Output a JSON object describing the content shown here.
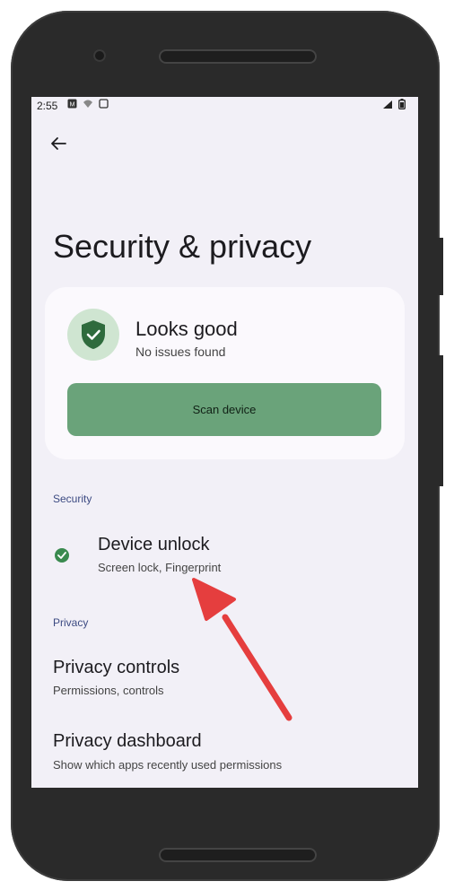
{
  "status_bar": {
    "time": "2:55",
    "left_icons": [
      "notification-icon",
      "wifi-off-icon",
      "screen-icon"
    ],
    "right_icons": [
      "signal-icon",
      "battery-icon"
    ]
  },
  "header": {
    "back_icon": "arrow-back-icon",
    "title": "Security & privacy"
  },
  "status_card": {
    "icon": "shield-check-icon",
    "title": "Looks good",
    "subtitle": "No issues found",
    "button_label": "Scan device"
  },
  "sections": {
    "security": {
      "label": "Security",
      "items": [
        {
          "icon": "check-circle-icon",
          "title": "Device unlock",
          "subtitle": "Screen lock, Fingerprint"
        }
      ]
    },
    "privacy": {
      "label": "Privacy",
      "items": [
        {
          "title": "Privacy controls",
          "subtitle": "Permissions, controls"
        },
        {
          "title": "Privacy dashboard",
          "subtitle": "Show which apps recently used permissions"
        }
      ]
    }
  },
  "annotation": {
    "icon": "red-arrow-icon"
  },
  "colors": {
    "accent_green": "#6aa37a",
    "shield_green": "#2f6b3d",
    "section_label": "#3c4a82",
    "arrow_red": "#e53e3e",
    "screen_bg": "#f2f0f7"
  }
}
